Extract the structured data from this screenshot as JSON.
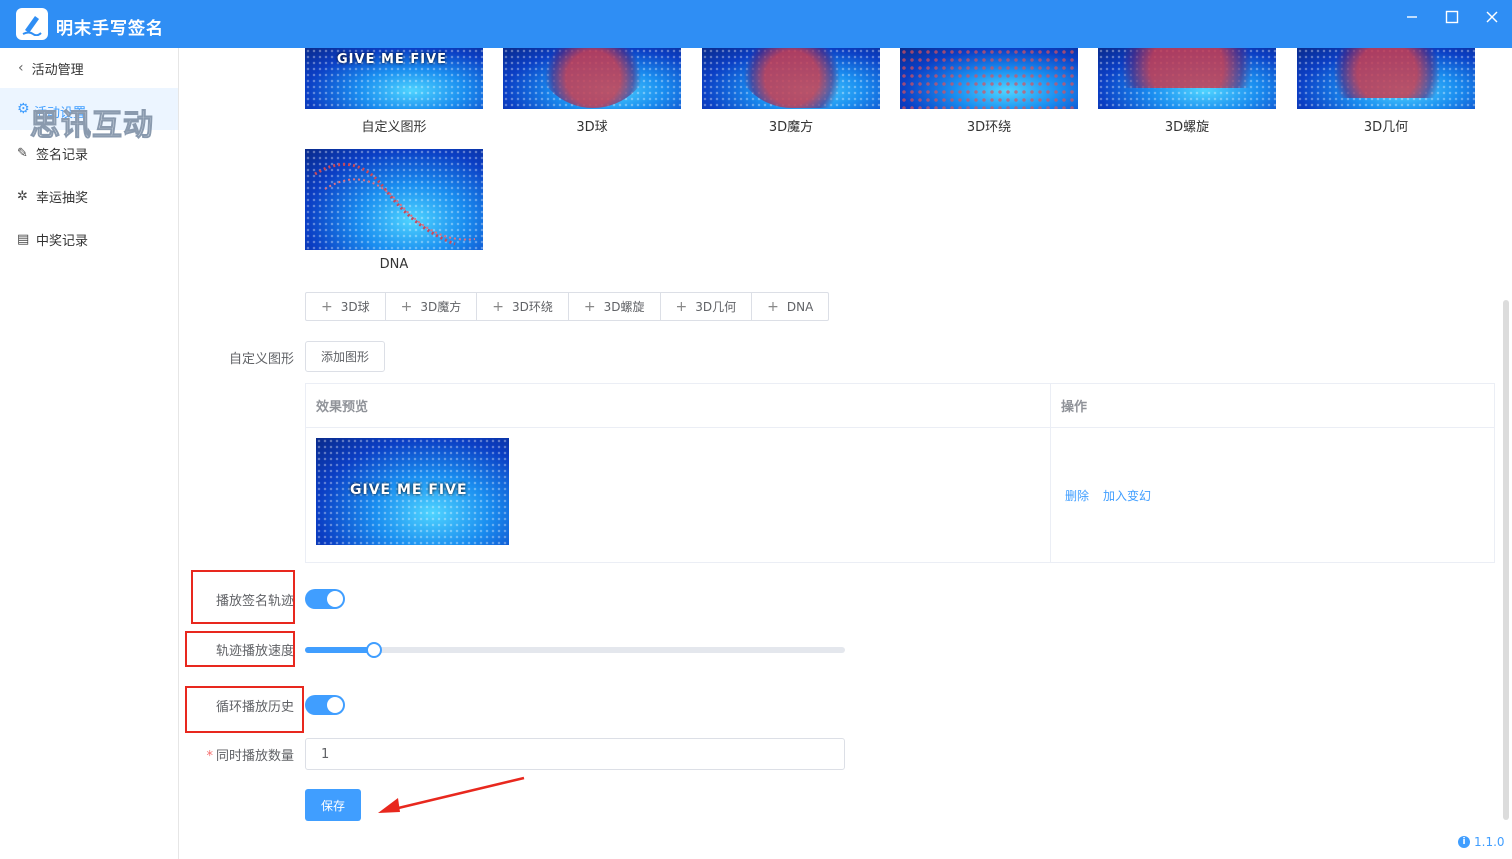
{
  "app": {
    "title": "明末手写签名"
  },
  "sidebar": {
    "back_label": "活动管理",
    "active_label": "活动设置",
    "watermark": "思讯互动",
    "items": [
      {
        "label": "签名记录",
        "icon": "signature-record-icon"
      },
      {
        "label": "幸运抽奖",
        "icon": "lottery-icon"
      },
      {
        "label": "中奖记录",
        "icon": "prize-record-icon"
      }
    ]
  },
  "effects": {
    "thumbs": [
      {
        "label": "自定义图形",
        "overlay": "GIVE ME FIVE"
      },
      {
        "label": "3D球"
      },
      {
        "label": "3D魔方"
      },
      {
        "label": "3D环绕"
      },
      {
        "label": "3D螺旋"
      },
      {
        "label": "3D几何"
      },
      {
        "label": "DNA"
      }
    ],
    "tags": [
      "3D球",
      "3D魔方",
      "3D环绕",
      "3D螺旋",
      "3D几何",
      "DNA"
    ]
  },
  "custom_shape": {
    "label": "自定义图形",
    "add_button": "添加图形",
    "table": {
      "col_preview": "效果预览",
      "col_actions": "操作",
      "row_overlay": "GIVE ME FIVE",
      "delete": "删除",
      "add_to_mix": "加入变幻"
    }
  },
  "settings": {
    "play_track_label": "播放签名轨迹",
    "play_track_on": true,
    "speed_label": "轨迹播放速度",
    "speed_fraction": 0.127,
    "loop_label": "循环播放历史",
    "loop_on": true,
    "concurrent_label": "同时播放数量",
    "concurrent_required_mark": "*",
    "concurrent_value": "1",
    "save": "保存"
  },
  "version": "1.1.0",
  "colors": {
    "titlebar": "#2f8ef4",
    "primary": "#409eff",
    "highlight": "#e8281e"
  }
}
